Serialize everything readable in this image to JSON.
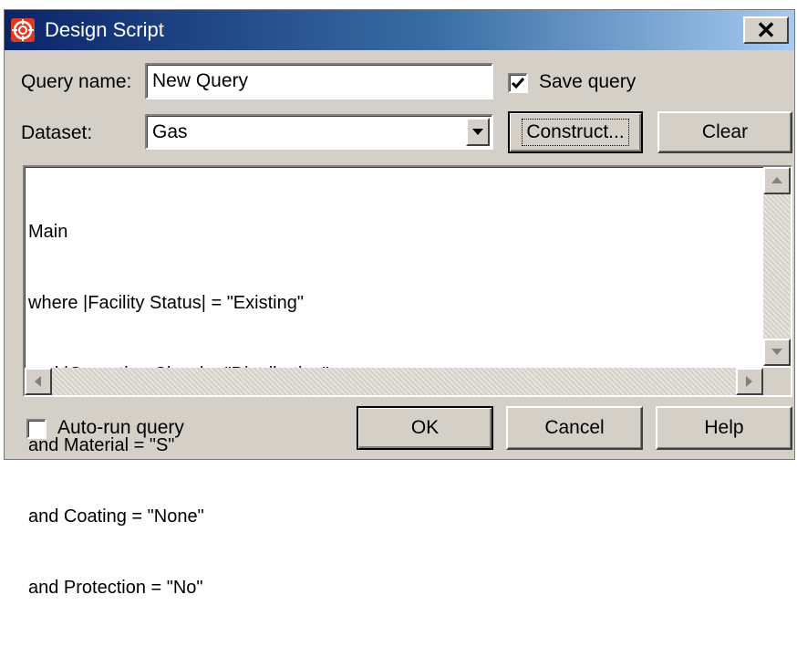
{
  "window": {
    "title": "Design Script",
    "close_label": "✕"
  },
  "query_name": {
    "label": "Query name:",
    "value": "New Query"
  },
  "save_query": {
    "label": "Save query",
    "checked": true
  },
  "dataset": {
    "label": "Dataset:",
    "value": "Gas"
  },
  "buttons": {
    "construct": "Construct...",
    "clear": "Clear",
    "ok": "OK",
    "cancel": "Cancel",
    "help": "Help"
  },
  "script": {
    "lines": [
      "Main",
      "where |Facility Status| = \"Existing\"",
      "and |Operating Class| = \"Distribution\"",
      "and Material = \"S\"",
      "and Coating = \"None\"",
      "and Protection = \"No\""
    ]
  },
  "auto_run": {
    "label": "Auto-run query",
    "checked": false
  },
  "colors": {
    "title_start": "#0a246a",
    "title_end": "#a6caf0",
    "face": "#d4d0c8"
  },
  "icons": [
    "app-target-icon",
    "close-icon",
    "checkmark-icon",
    "dropdown-arrow-icon",
    "scroll-up-icon",
    "scroll-down-icon",
    "scroll-left-icon",
    "scroll-right-icon"
  ]
}
